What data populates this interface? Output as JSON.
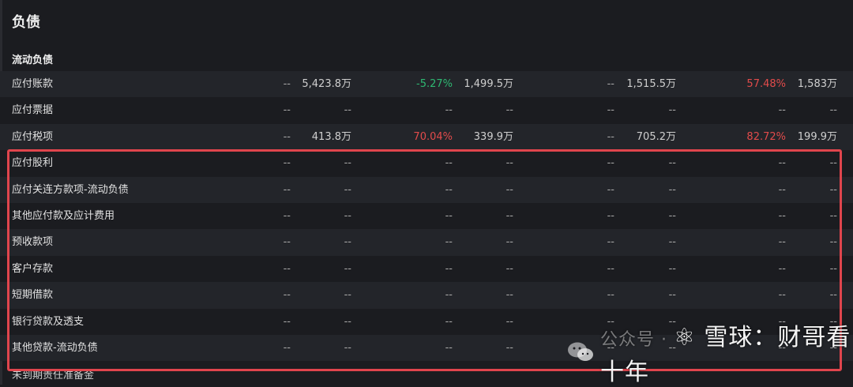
{
  "page": {
    "title": "负债",
    "section": "流动负债"
  },
  "rows": [
    {
      "label": "应付账款",
      "cells": [
        {
          "pct": "--",
          "val": "5,423.8万",
          "pct_class": "dash"
        },
        {
          "pct": "-5.27%",
          "val": "1,499.5万",
          "pct_class": "neg"
        },
        {
          "pct": "--",
          "val": "1,515.5万",
          "pct_class": "dash"
        },
        {
          "pct": "57.48%",
          "val": "1,583万",
          "pct_class": "pos"
        }
      ]
    },
    {
      "label": "应付票据",
      "cells": [
        {
          "pct": "--",
          "val": "--",
          "pct_class": "dash"
        },
        {
          "pct": "--",
          "val": "--",
          "pct_class": "dash"
        },
        {
          "pct": "--",
          "val": "--",
          "pct_class": "dash"
        },
        {
          "pct": "--",
          "val": "--",
          "pct_class": "dash"
        }
      ]
    },
    {
      "label": "应付税项",
      "cells": [
        {
          "pct": "--",
          "val": "413.8万",
          "pct_class": "dash"
        },
        {
          "pct": "70.04%",
          "val": "339.9万",
          "pct_class": "pos"
        },
        {
          "pct": "--",
          "val": "705.2万",
          "pct_class": "dash"
        },
        {
          "pct": "82.72%",
          "val": "199.9万",
          "pct_class": "pos"
        }
      ]
    },
    {
      "label": "应付股利",
      "cells": [
        {
          "pct": "--",
          "val": "--",
          "pct_class": "dash"
        },
        {
          "pct": "--",
          "val": "--",
          "pct_class": "dash"
        },
        {
          "pct": "--",
          "val": "--",
          "pct_class": "dash"
        },
        {
          "pct": "--",
          "val": "--",
          "pct_class": "dash"
        }
      ]
    },
    {
      "label": "应付关连方款项-流动负债",
      "cells": [
        {
          "pct": "--",
          "val": "--",
          "pct_class": "dash"
        },
        {
          "pct": "--",
          "val": "--",
          "pct_class": "dash"
        },
        {
          "pct": "--",
          "val": "--",
          "pct_class": "dash"
        },
        {
          "pct": "--",
          "val": "--",
          "pct_class": "dash"
        }
      ]
    },
    {
      "label": "其他应付款及应计费用",
      "cells": [
        {
          "pct": "--",
          "val": "--",
          "pct_class": "dash"
        },
        {
          "pct": "--",
          "val": "--",
          "pct_class": "dash"
        },
        {
          "pct": "--",
          "val": "--",
          "pct_class": "dash"
        },
        {
          "pct": "--",
          "val": "--",
          "pct_class": "dash"
        }
      ]
    },
    {
      "label": "预收款项",
      "cells": [
        {
          "pct": "--",
          "val": "--",
          "pct_class": "dash"
        },
        {
          "pct": "--",
          "val": "--",
          "pct_class": "dash"
        },
        {
          "pct": "--",
          "val": "--",
          "pct_class": "dash"
        },
        {
          "pct": "--",
          "val": "--",
          "pct_class": "dash"
        }
      ]
    },
    {
      "label": "客户存款",
      "cells": [
        {
          "pct": "--",
          "val": "--",
          "pct_class": "dash"
        },
        {
          "pct": "--",
          "val": "--",
          "pct_class": "dash"
        },
        {
          "pct": "--",
          "val": "--",
          "pct_class": "dash"
        },
        {
          "pct": "--",
          "val": "--",
          "pct_class": "dash"
        }
      ]
    },
    {
      "label": "短期借款",
      "cells": [
        {
          "pct": "--",
          "val": "--",
          "pct_class": "dash"
        },
        {
          "pct": "--",
          "val": "--",
          "pct_class": "dash"
        },
        {
          "pct": "--",
          "val": "--",
          "pct_class": "dash"
        },
        {
          "pct": "--",
          "val": "--",
          "pct_class": "dash"
        }
      ]
    },
    {
      "label": "银行贷款及透支",
      "cells": [
        {
          "pct": "--",
          "val": "--",
          "pct_class": "dash"
        },
        {
          "pct": "--",
          "val": "--",
          "pct_class": "dash"
        },
        {
          "pct": "--",
          "val": "--",
          "pct_class": "dash"
        },
        {
          "pct": "--",
          "val": "--",
          "pct_class": "dash"
        }
      ]
    },
    {
      "label": "其他贷款-流动负债",
      "cells": [
        {
          "pct": "--",
          "val": "--",
          "pct_class": "dash"
        },
        {
          "pct": "--",
          "val": "--",
          "pct_class": "dash"
        },
        {
          "pct": "--",
          "val": "--",
          "pct_class": "dash"
        },
        {
          "pct": "--",
          "val": "--",
          "pct_class": "dash"
        }
      ]
    }
  ],
  "cutoff_row_label": "未到期责任准备金",
  "watermark": {
    "prefix": "公众号 · ",
    "text": "雪球：财哥看十年"
  },
  "colors": {
    "highlight": "#e0454d",
    "negative": "#2eb872",
    "positive": "#e24b4b",
    "background": "#1b1c20"
  },
  "icons": [
    "wechat-icon",
    "snowball-icon"
  ]
}
